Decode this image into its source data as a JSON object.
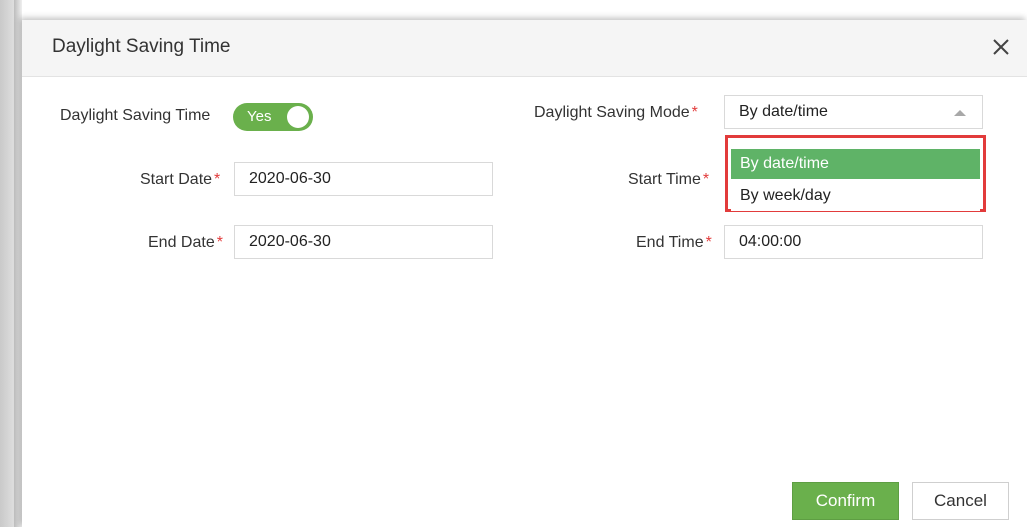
{
  "dialog": {
    "title": "Daylight Saving Time",
    "close_icon": "close-icon"
  },
  "form": {
    "dst_label": "Daylight Saving Time",
    "dst_toggle_value": "Yes",
    "mode_label": "Daylight Saving Mode",
    "mode_value": "By date/time",
    "mode_options": [
      "By date/time",
      "By week/day"
    ],
    "start_date_label": "Start Date",
    "start_date_value": "2020-06-30",
    "start_time_label": "Start Time",
    "end_date_label": "End Date",
    "end_date_value": "2020-06-30",
    "end_time_label": "End Time",
    "end_time_value": "04:00:00",
    "required_mark": "*"
  },
  "footer": {
    "confirm_label": "Confirm",
    "cancel_label": "Cancel"
  },
  "colors": {
    "accent": "#6ab04c",
    "selected_option": "#5fb367",
    "required": "#e23b3b",
    "highlight_box": "#e23b3b"
  }
}
